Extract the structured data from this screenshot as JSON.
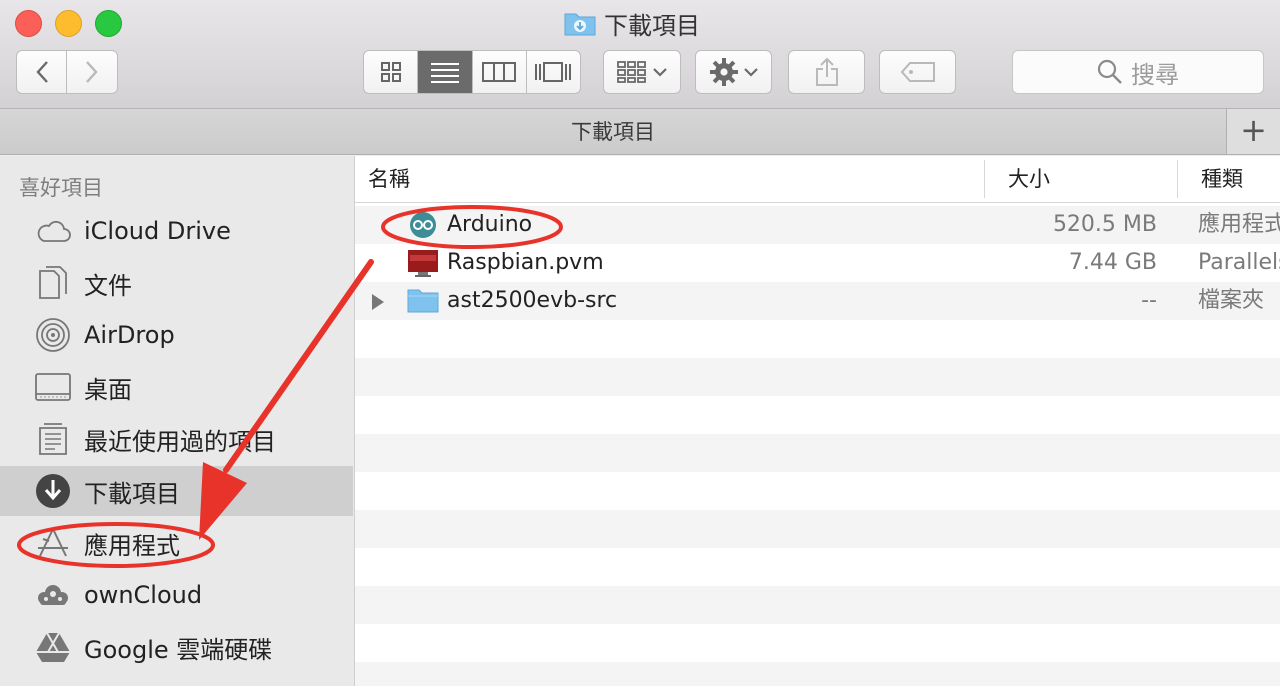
{
  "window": {
    "title": "下載項目"
  },
  "toolbar": {
    "back_icon": "chevron-left",
    "forward_icon": "chevron-right",
    "view_icons": [
      "icon-view",
      "list-view",
      "column-view",
      "coverflow-view"
    ],
    "search_placeholder": "搜尋"
  },
  "tab": {
    "label": "下載項目",
    "add_label": "+"
  },
  "sidebar": {
    "header": "喜好項目",
    "items": [
      {
        "label": "iCloud Drive",
        "icon": "cloud-icon"
      },
      {
        "label": "文件",
        "icon": "document-icon"
      },
      {
        "label": "AirDrop",
        "icon": "airdrop-icon"
      },
      {
        "label": "桌面",
        "icon": "desktop-icon"
      },
      {
        "label": "最近使用過的項目",
        "icon": "recents-icon"
      },
      {
        "label": "下載項目",
        "icon": "download-icon",
        "selected": true
      },
      {
        "label": "應用程式",
        "icon": "applications-icon"
      },
      {
        "label": "ownCloud",
        "icon": "owncloud-icon"
      },
      {
        "label": "Google 雲端硬碟",
        "icon": "google-drive-icon"
      }
    ]
  },
  "columns": {
    "name": "名稱",
    "size": "大小",
    "kind": "種類"
  },
  "files": [
    {
      "name": "Arduino",
      "size": "520.5 MB",
      "kind": "應用程式",
      "icon": "arduino-app-icon"
    },
    {
      "name": "Raspbian.pvm",
      "size": "7.44 GB",
      "kind": "Parallels",
      "icon": "parallels-vm-icon"
    },
    {
      "name": "ast2500evb-src",
      "size": "--",
      "kind": "檔案夾",
      "icon": "folder-icon"
    }
  ],
  "colors": {
    "annotation_red": "#e8332b",
    "selection_gray": "#cfcfcf",
    "folder_blue": "#7fc2ee"
  }
}
